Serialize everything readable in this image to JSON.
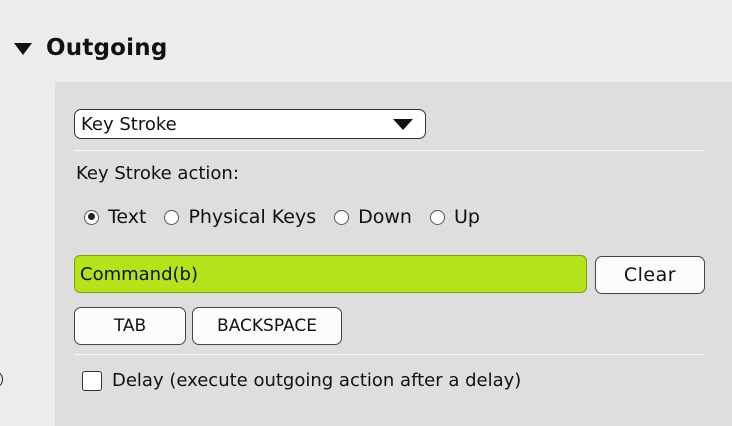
{
  "section": {
    "title": "Outgoing",
    "expanded": true,
    "toggle_icon": "disclosure-triangle-down-icon"
  },
  "action_type": {
    "selected": "Key Stroke",
    "arrow_icon": "dropdown-arrow-icon"
  },
  "keystroke": {
    "label": "Key Stroke action:",
    "modes": [
      {
        "label": "Text",
        "selected": true
      },
      {
        "label": "Physical Keys",
        "selected": false
      },
      {
        "label": "Down",
        "selected": false
      },
      {
        "label": "Up",
        "selected": false
      }
    ],
    "text_value": "Command(b)",
    "text_field_color": "#b5e31b",
    "clear_label": "Clear",
    "key_buttons": [
      "TAB",
      "BACKSPACE"
    ]
  },
  "delay": {
    "label": "Delay (execute outgoing action after a delay)",
    "checked": false
  }
}
